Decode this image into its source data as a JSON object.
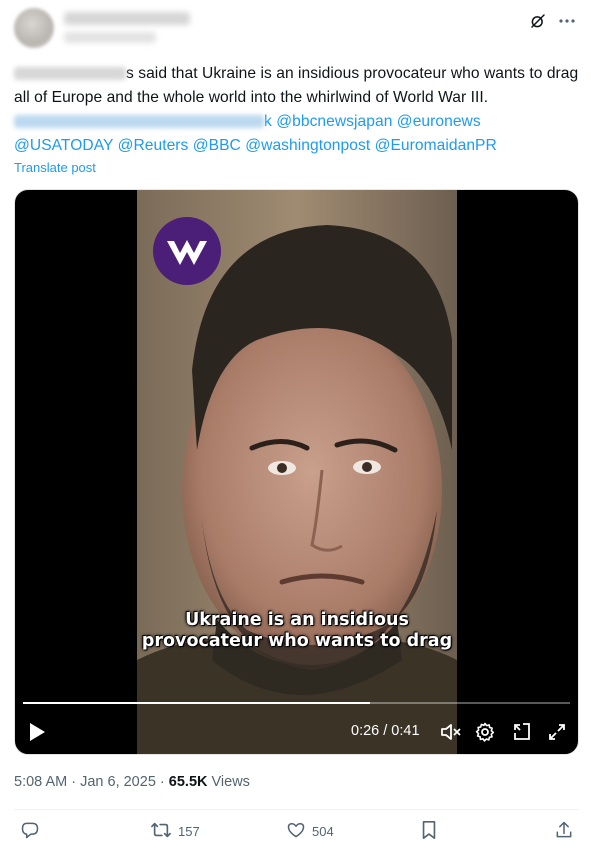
{
  "post": {
    "text_part1": "s said that Ukraine is an insidious provocateur who wants to drag all of Europe and the whole world into the whirlwind of World War III.",
    "mention_tail": "k",
    "mentions": "@bbcnewsjapan @euronews @USATODAY @Reuters @BBC @washingtonpost @EuromaidanPR",
    "translate_label": "Translate post"
  },
  "video": {
    "caption_line1": "Ukraine is an insidious",
    "caption_line2": "provocateur who wants to drag",
    "time": "0:26 / 0:41",
    "progress_fraction": 0.634
  },
  "meta": {
    "time": "5:08 AM",
    "separator": " · ",
    "date": "Jan 6, 2025",
    "views_count": "65.5K",
    "views_label": "Views"
  },
  "actions": {
    "reposts": "157",
    "likes": "504"
  },
  "colors": {
    "accent": "#1d9bf0",
    "muted": "#536471",
    "logo_purple": "#4b1e78"
  },
  "icons": [
    "grok-icon",
    "more-icon",
    "play-icon",
    "volume-muted-icon",
    "settings-icon",
    "pip-icon",
    "fullscreen-icon",
    "reply-icon",
    "repost-icon",
    "like-icon",
    "bookmark-icon",
    "share-icon"
  ]
}
